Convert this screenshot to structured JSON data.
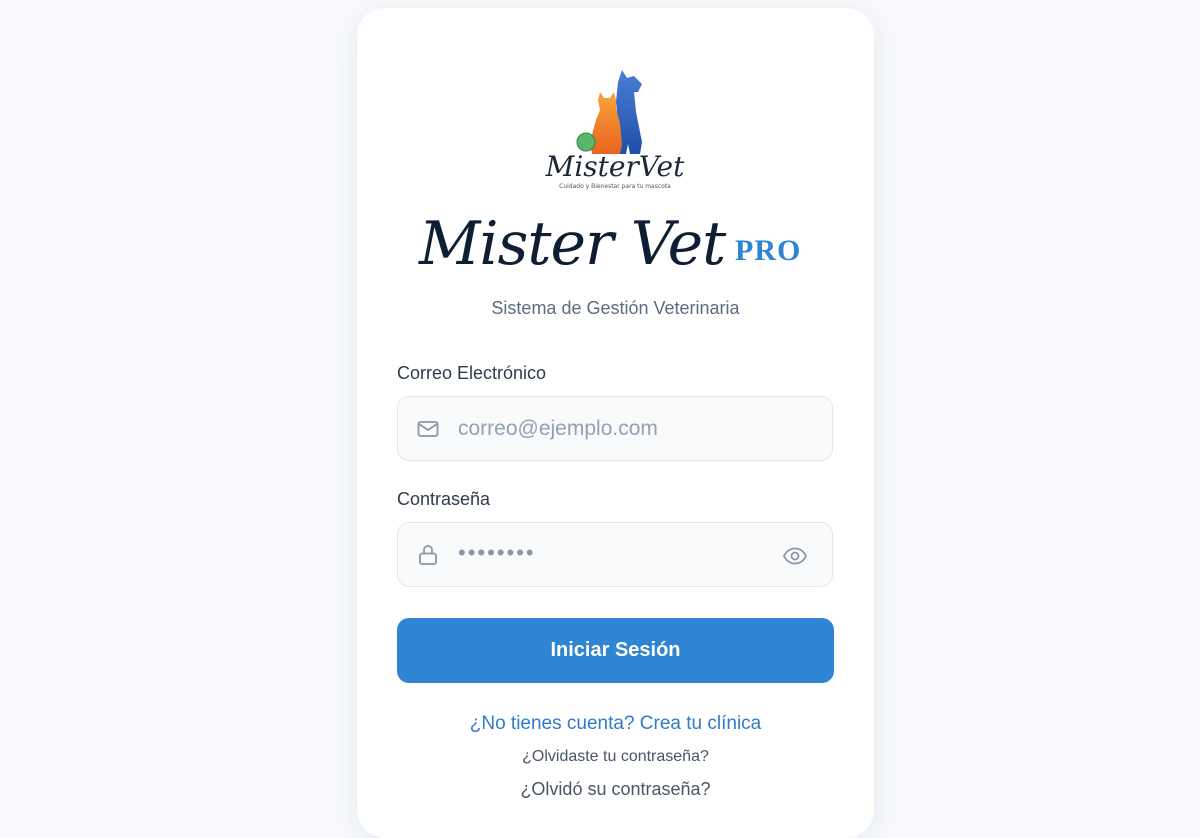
{
  "logo": {
    "wordmark": "MisterVet",
    "tagline": "Cuidado y Bienestar para tu mascota"
  },
  "brand": {
    "name": "Mister Vet",
    "suffix": "PRO",
    "subtitle": "Sistema de Gestión Veterinaria"
  },
  "form": {
    "email_label": "Correo Electrónico",
    "email_placeholder": "correo@ejemplo.com",
    "email_icon": "mail-icon",
    "password_label": "Contraseña",
    "password_masked": "••••••••",
    "password_icon": "lock-icon",
    "toggle_icon": "eye-icon",
    "submit_label": "Iniciar Sesión"
  },
  "links": {
    "create_account": "¿No tienes cuenta? Crea tu clínica",
    "forgot_1": "¿Olvidaste tu contraseña?",
    "forgot_2": "¿Olvidó su contraseña?"
  },
  "colors": {
    "accent": "#2f84d4",
    "link": "#2f7bc6",
    "text_dark": "#0f1f33",
    "background": "#f7f9fc"
  }
}
